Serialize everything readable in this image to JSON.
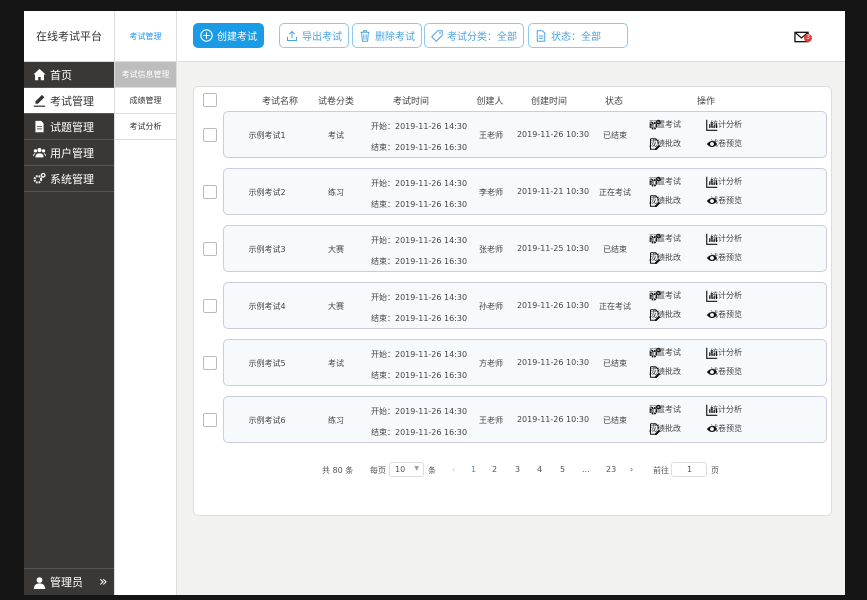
{
  "app": {
    "title": "在线考试平台"
  },
  "sidebar": {
    "items": [
      {
        "label": "首页",
        "icon": "home-icon"
      },
      {
        "label": "考试管理",
        "icon": "pencil-icon"
      },
      {
        "label": "试题管理",
        "icon": "document-icon"
      },
      {
        "label": "用户管理",
        "icon": "users-icon"
      },
      {
        "label": "系统管理",
        "icon": "gears-icon"
      }
    ],
    "active": 1,
    "user": "管理员",
    "expand": "»"
  },
  "submenu": {
    "title": "考试管理",
    "items": [
      "考试信息管理",
      "成绩管理",
      "考试分析"
    ]
  },
  "toolbar": {
    "create": "创建考试",
    "export": "导出考试",
    "delete": "删除考试",
    "category": "考试分类：全部",
    "status": "状态：全部",
    "mail_badge": "3"
  },
  "table": {
    "headers": [
      "考试名称",
      "试卷分类",
      "考试时间",
      "创建人",
      "创建时间",
      "状态",
      "操作"
    ],
    "ops": [
      "配置考试",
      "统计分析",
      "成绩批改",
      "试卷预览"
    ],
    "rows": [
      {
        "name": "示例考试1",
        "type": "考试",
        "start": "开始：2019-11-26 14:30",
        "end": "结束：2019-11-26 16:30",
        "creator": "王老师",
        "created": "2019-11-26 10:30",
        "status": "已结束"
      },
      {
        "name": "示例考试2",
        "type": "练习",
        "start": "开始：2019-11-26 14:30",
        "end": "结束：2019-11-26 16:30",
        "creator": "李老师",
        "created": "2019-11-21 10:30",
        "status": "正在考试"
      },
      {
        "name": "示例考试3",
        "type": "大赛",
        "start": "开始：2019-11-26 14:30",
        "end": "结束：2019-11-26 16:30",
        "creator": "张老师",
        "created": "2019-11-25 10:30",
        "status": "已结束"
      },
      {
        "name": "示例考试4",
        "type": "大赛",
        "start": "开始：2019-11-26 14:30",
        "end": "结束：2019-11-26 16:30",
        "creator": "孙老师",
        "created": "2019-11-26 10:30",
        "status": "正在考试"
      },
      {
        "name": "示例考试5",
        "type": "考试",
        "start": "开始：2019-11-26 14:30",
        "end": "结束：2019-11-26 16:30",
        "creator": "方老师",
        "created": "2019-11-26 10:30",
        "status": "已结束"
      },
      {
        "name": "示例考试6",
        "type": "练习",
        "start": "开始：2019-11-26 14:30",
        "end": "结束：2019-11-26 16:30",
        "creator": "王老师",
        "created": "2019-11-26 10:30",
        "status": "已结束"
      }
    ]
  },
  "pagination": {
    "total": "共 80 条",
    "per_page_label": "每页",
    "per_page": "10",
    "unit": "条",
    "pages": [
      "1",
      "2",
      "3",
      "4",
      "5",
      "...",
      "23"
    ],
    "current": "1",
    "goto_label": "前往",
    "goto_value": "1",
    "page_unit": "页"
  }
}
